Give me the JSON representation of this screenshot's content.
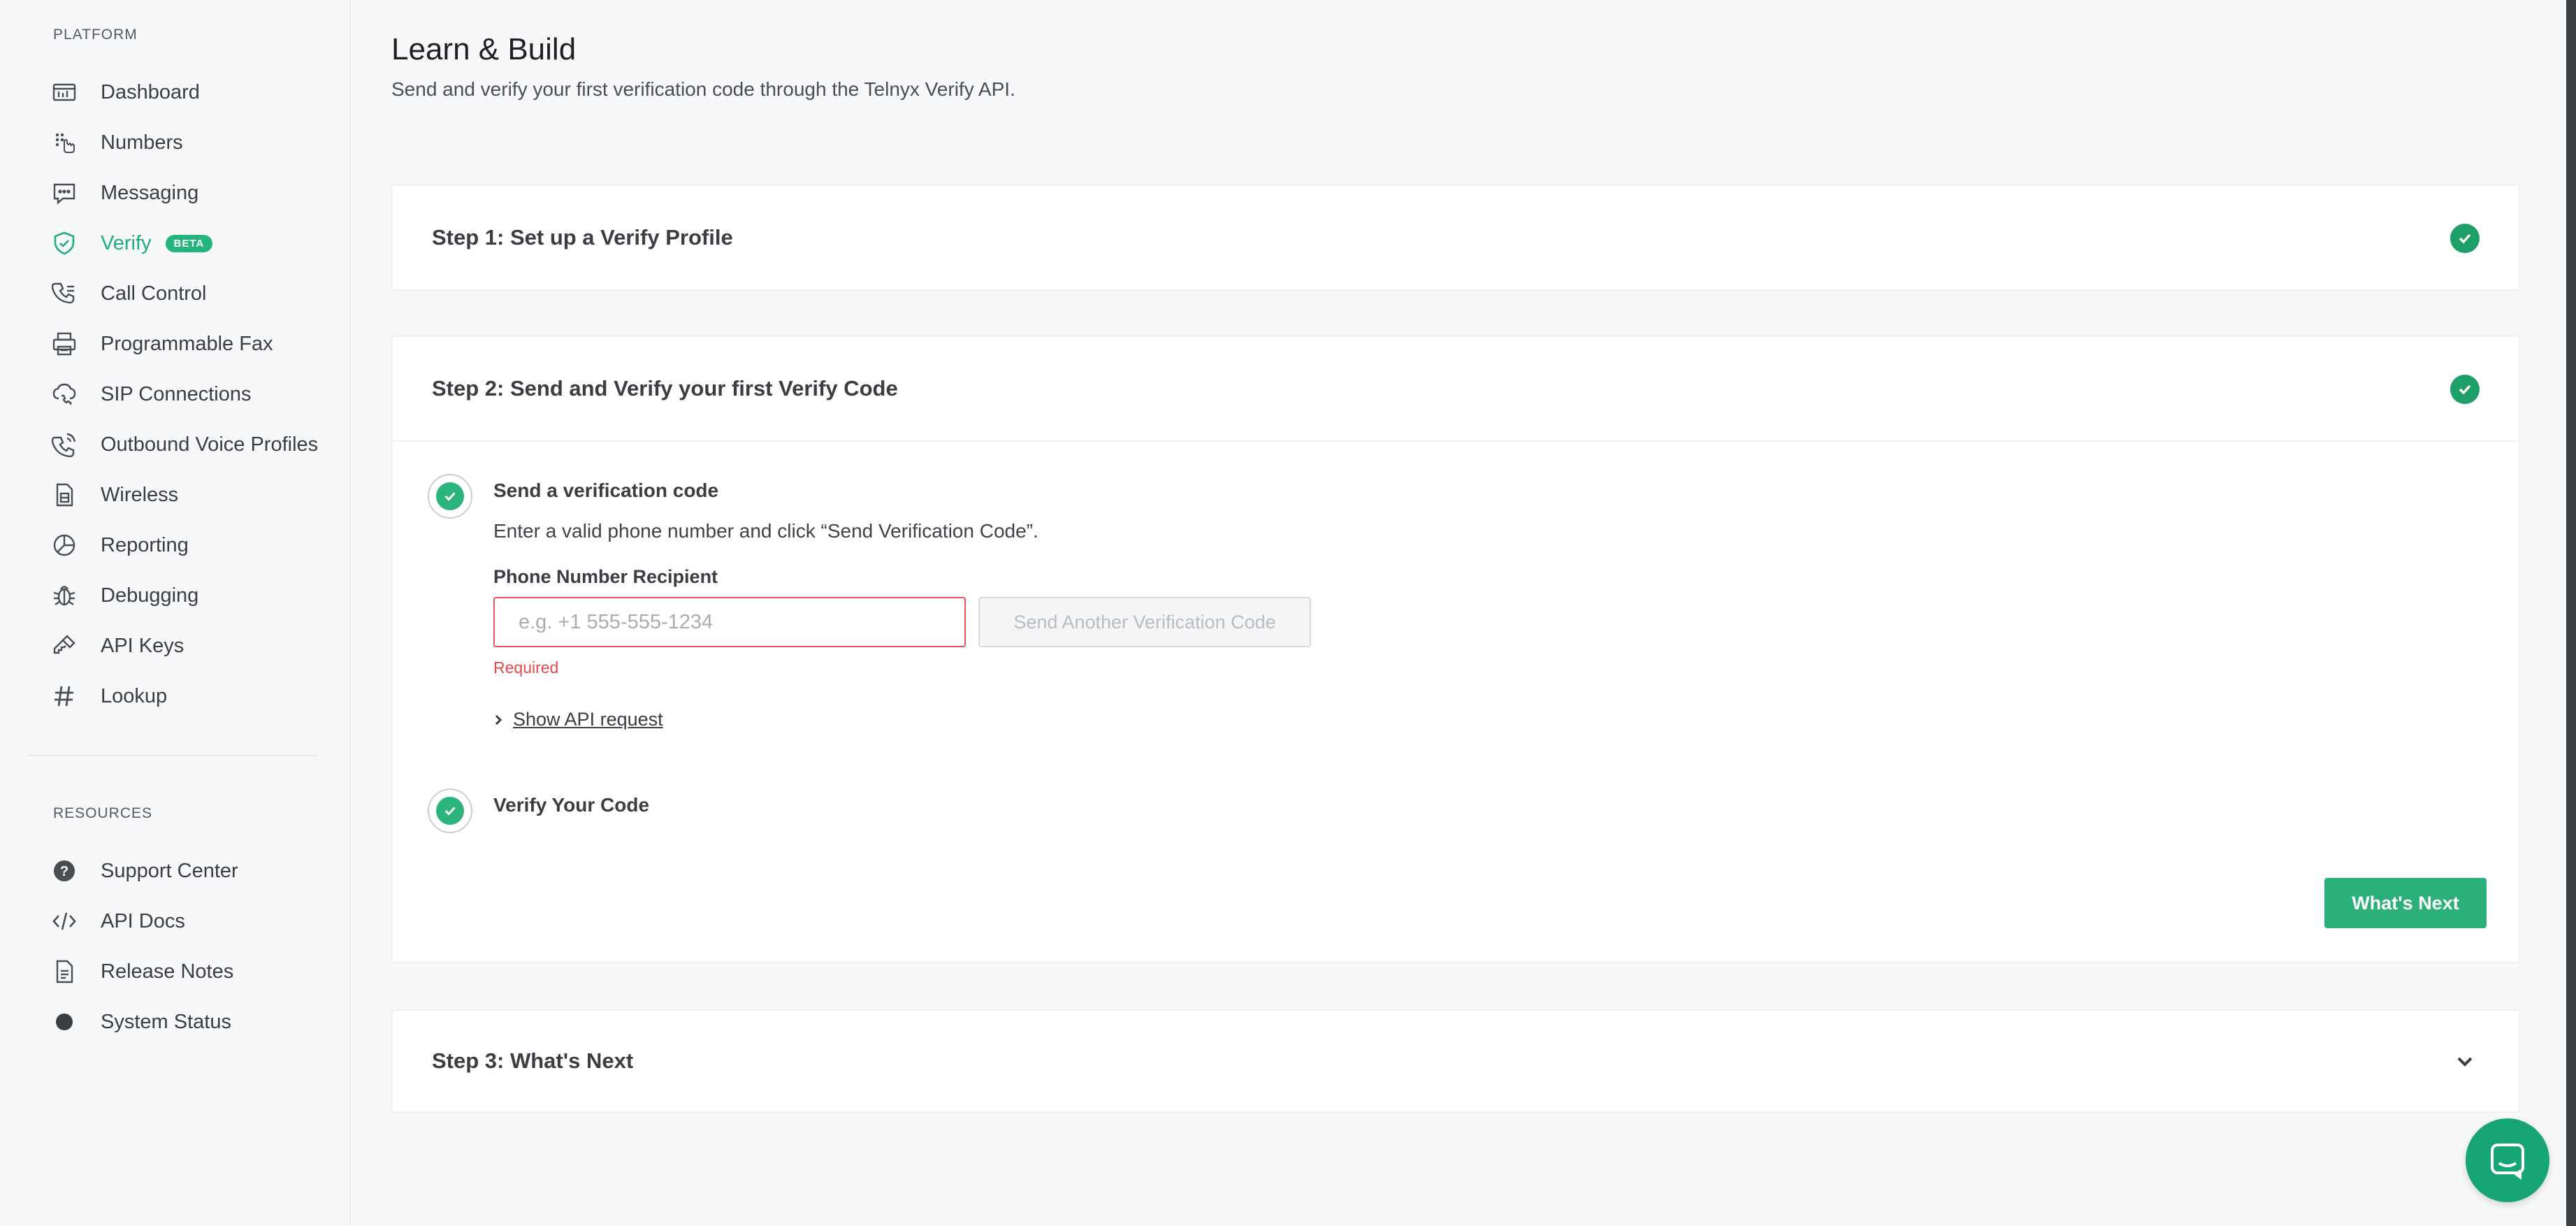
{
  "sidebar": {
    "platform_label": "PLATFORM",
    "platform_items": [
      {
        "label": "Dashboard",
        "icon": "dashboard-icon"
      },
      {
        "label": "Numbers",
        "icon": "numbers-icon"
      },
      {
        "label": "Messaging",
        "icon": "messaging-icon"
      },
      {
        "label": "Verify",
        "icon": "shield-check-icon",
        "badge": "BETA",
        "active": true
      },
      {
        "label": "Call Control",
        "icon": "phone-icon"
      },
      {
        "label": "Programmable Fax",
        "icon": "fax-icon"
      },
      {
        "label": "SIP Connections",
        "icon": "sip-icon"
      },
      {
        "label": "Outbound Voice Profiles",
        "icon": "outbound-phone-icon"
      },
      {
        "label": "Wireless",
        "icon": "sim-card-icon"
      },
      {
        "label": "Reporting",
        "icon": "pie-chart-icon"
      },
      {
        "label": "Debugging",
        "icon": "bug-icon"
      },
      {
        "label": "API Keys",
        "icon": "key-icon"
      },
      {
        "label": "Lookup",
        "icon": "hashtag-icon"
      }
    ],
    "resources_label": "RESOURCES",
    "resource_items": [
      {
        "label": "Support Center",
        "icon": "help-circle-icon"
      },
      {
        "label": "API Docs",
        "icon": "code-icon"
      },
      {
        "label": "Release Notes",
        "icon": "document-icon"
      },
      {
        "label": "System Status",
        "icon": "status-dot-icon"
      }
    ]
  },
  "main": {
    "title": "Learn & Build",
    "subtitle": "Send and verify your first verification code through the Telnyx Verify API.",
    "step1_title": "Step 1: Set up a Verify Profile",
    "step2_title": "Step 2: Send and Verify your first Verify Code",
    "send_title": "Send a verification code",
    "send_instructions": "Enter a valid phone number and click “Send Verification Code”.",
    "phone_label": "Phone Number Recipient",
    "phone_placeholder": "e.g. +1 555-555-1234",
    "phone_value": "",
    "send_again_label": "Send Another Verification Code",
    "error_text": "Required",
    "show_api_label": "Show API request",
    "verify_title": "Verify Your Code",
    "whats_next_button": "What's Next",
    "step3_title": "Step 3: What's Next"
  },
  "colors": {
    "accent": "#2bb07a",
    "active_nav": "#1faf74",
    "error": "#e5484f"
  }
}
